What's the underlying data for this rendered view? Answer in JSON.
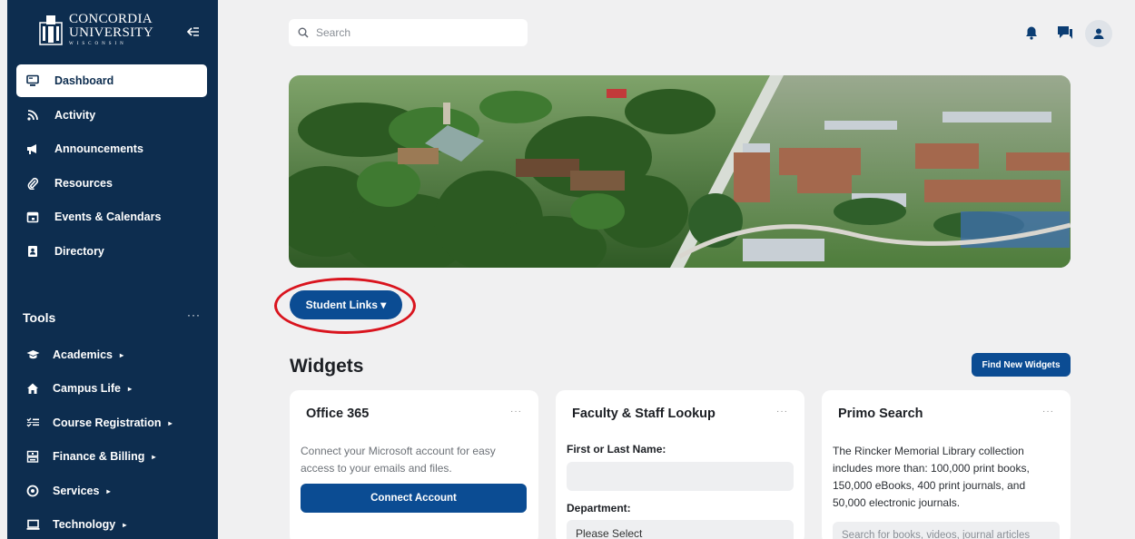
{
  "brand": {
    "line1": "CONCORDIA",
    "line2": "UNIVERSITY",
    "line3": "WISCONSIN"
  },
  "sidebar": {
    "items": [
      {
        "label": "Dashboard",
        "icon": "monitor-icon",
        "active": true
      },
      {
        "label": "Activity",
        "icon": "rss-icon"
      },
      {
        "label": "Announcements",
        "icon": "megaphone-icon"
      },
      {
        "label": "Resources",
        "icon": "paperclip-icon"
      },
      {
        "label": "Events & Calendars",
        "icon": "calendar-icon"
      },
      {
        "label": "Directory",
        "icon": "address-book-icon"
      }
    ],
    "tools_title": "Tools",
    "tools_more": "···",
    "tools": [
      {
        "label": "Academics",
        "icon": "graduation-cap-icon"
      },
      {
        "label": "Campus Life",
        "icon": "home-icon"
      },
      {
        "label": "Course Registration",
        "icon": "list-check-icon"
      },
      {
        "label": "Finance & Billing",
        "icon": "cash-register-icon"
      },
      {
        "label": "Services",
        "icon": "services-icon"
      },
      {
        "label": "Technology",
        "icon": "laptop-icon"
      }
    ]
  },
  "search": {
    "placeholder": "Search"
  },
  "student_links": {
    "label": "Student Links ▾"
  },
  "widgets": {
    "title": "Widgets",
    "find_button": "Find New Widgets",
    "more": "···",
    "office": {
      "title": "Office 365",
      "text": "Connect your Microsoft account for easy access to your emails and files.",
      "button": "Connect Account"
    },
    "lookup": {
      "title": "Faculty & Staff Lookup",
      "name_label": "First or Last Name:",
      "dept_label": "Department:",
      "dept_value": "Please Select"
    },
    "primo": {
      "title": "Primo Search",
      "text": "The Rincker Memorial Library collection includes more than: 100,000 print books, 150,000 eBooks, 400 print journals, and 50,000 electronic journals.",
      "placeholder": "Search for books, videos, journal articles"
    }
  },
  "colors": {
    "sidebar": "#0d2d4f",
    "primary": "#0b4c93",
    "highlight": "#d9141e"
  }
}
